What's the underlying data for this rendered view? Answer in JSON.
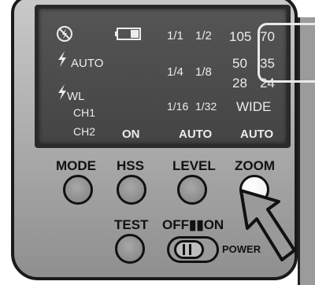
{
  "lcd": {
    "row1": {
      "icon": "no-flash-icon",
      "battery_icon": "battery-icon",
      "ratio_a": "1/1",
      "ratio_b": "1/2",
      "zoom_a": "105",
      "zoom_b": "70"
    },
    "row2": {
      "mode_label": "AUTO",
      "ratio_a": "1/4",
      "ratio_b": "1/8",
      "zoom_a": "50",
      "zoom_b": "35"
    },
    "row3": {
      "mode_label": "WL",
      "zoom_a": "28",
      "zoom_b": "24"
    },
    "row4": {
      "ch1": "CH1",
      "ratio_a": "1/16",
      "ratio_b": "1/32",
      "zoom_wide": "WIDE"
    },
    "row5": {
      "ch2": "CH2",
      "hss_value": "ON",
      "level_value": "AUTO",
      "zoom_value": "AUTO"
    }
  },
  "buttons": {
    "mode": "MODE",
    "hss": "HSS",
    "level": "LEVEL",
    "zoom": "ZOOM",
    "test": "TEST"
  },
  "power_switch": {
    "label": "OFF▮▮ON",
    "power": "POWER"
  },
  "colors": {
    "lcd_bg": "#4a4a4a",
    "lcd_text": "#ececec",
    "housing": "#b0b0b0"
  }
}
